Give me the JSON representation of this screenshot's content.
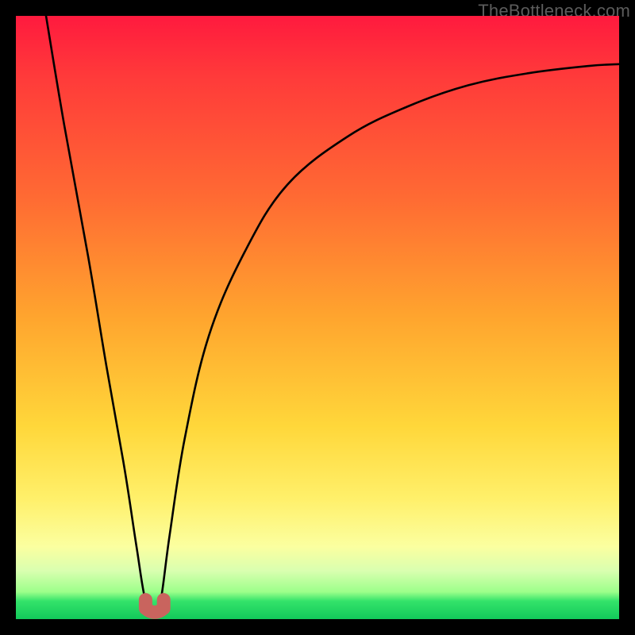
{
  "watermark": {
    "text": "TheBottleneck.com"
  },
  "colors": {
    "frame": "#000000",
    "curve": "#000000",
    "dip_marker": "#c9645e",
    "gradient_top": "#ff1a3e",
    "gradient_bottom": "#12c95a"
  },
  "chart_data": {
    "type": "line",
    "title": "",
    "xlabel": "",
    "ylabel": "",
    "xlim": [
      0,
      100
    ],
    "ylim": [
      0,
      100
    ],
    "grid": false,
    "annotations": [],
    "series": [
      {
        "name": "bottleneck-curve",
        "x": [
          5,
          8,
          12,
          15,
          18,
          20,
          21.5,
          23,
          24,
          25.5,
          28,
          32,
          38,
          45,
          55,
          65,
          75,
          85,
          95,
          100
        ],
        "y": [
          100,
          82,
          60,
          42,
          25,
          12,
          3,
          1,
          3,
          14,
          30,
          47,
          61,
          72,
          80,
          85,
          88.5,
          90.5,
          91.7,
          92
        ]
      }
    ],
    "dip": {
      "x_center": 23,
      "y": 1,
      "width": 3
    }
  }
}
